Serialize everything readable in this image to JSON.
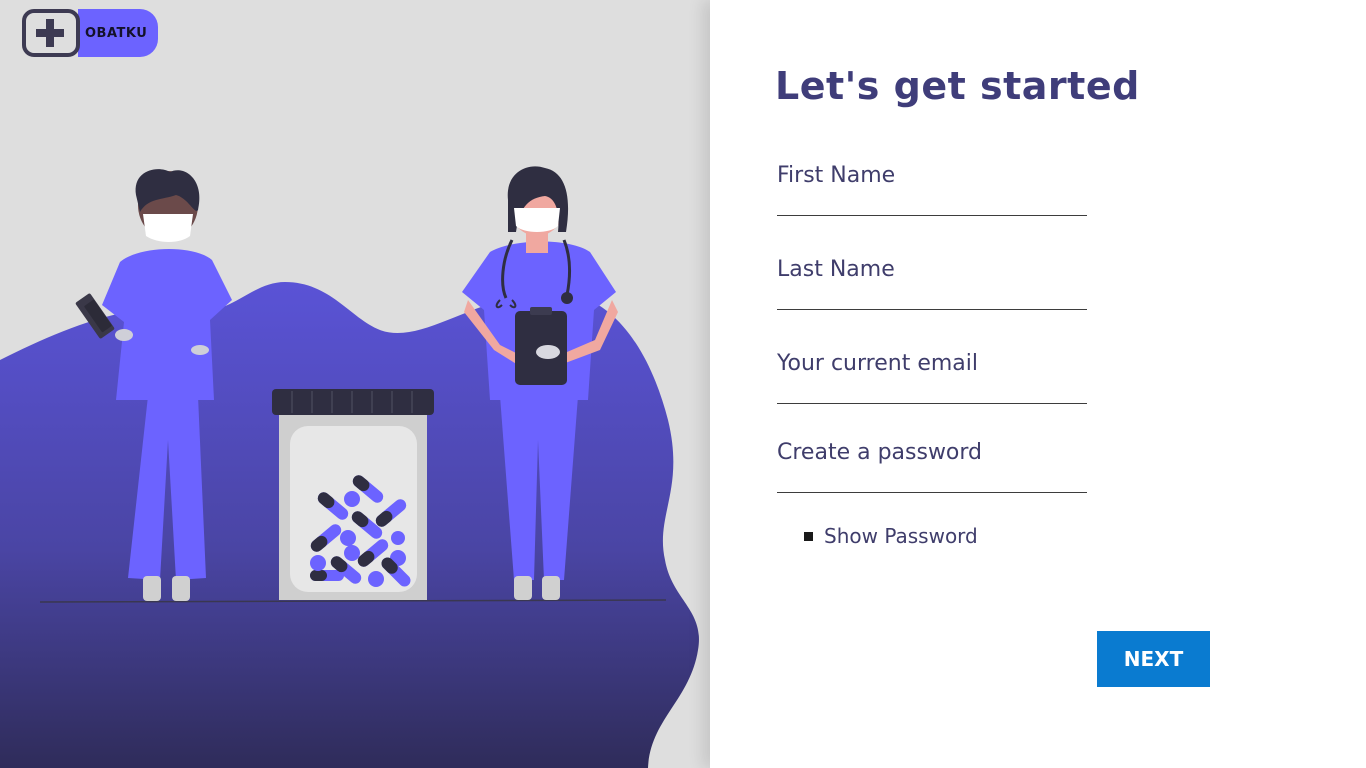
{
  "logo": {
    "text": "OBATKU",
    "icon": "plus-icon",
    "accent": "#6c63ff"
  },
  "form": {
    "title": "Let's get started",
    "fields": [
      {
        "label": "First Name",
        "value": "",
        "placeholder": ""
      },
      {
        "label": "Last Name",
        "value": "",
        "placeholder": ""
      },
      {
        "label": "Your current email",
        "value": "",
        "placeholder": ""
      },
      {
        "label": "Create a password",
        "value": "",
        "placeholder": ""
      }
    ],
    "show_password": {
      "label": "Show Password",
      "checked": false
    },
    "next_label": "NEXT"
  },
  "colors": {
    "accent": "#6c63ff",
    "title": "#3f3d7a",
    "button": "#0a7bd0",
    "panel_bg": "#dedede",
    "blob_top": "#5a53d6",
    "blob_bottom": "#2f2c5a"
  },
  "illustration": {
    "subject": "two medical workers with a pill jar",
    "icons": [
      "doctor-figure",
      "nurse-figure",
      "pill-jar",
      "stethoscope-icon",
      "clipboard-icon",
      "tablet-icon"
    ]
  }
}
